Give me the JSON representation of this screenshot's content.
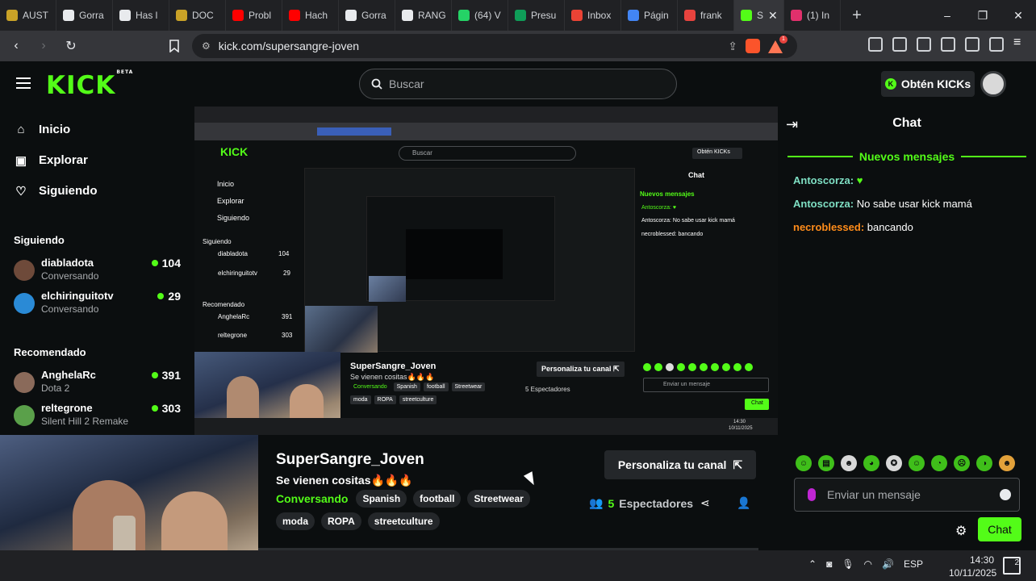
{
  "browser": {
    "tabs": [
      {
        "label": "AUST",
        "color": "#c9a227"
      },
      {
        "label": "Gorra",
        "color": "#e8eaed"
      },
      {
        "label": "Has l",
        "color": "#e8eaed"
      },
      {
        "label": "DOC",
        "color": "#c9a227"
      },
      {
        "label": "Probl",
        "color": "#ff0000"
      },
      {
        "label": "Hach",
        "color": "#ff0000"
      },
      {
        "label": "Gorra",
        "color": "#e8eaed"
      },
      {
        "label": "RANG",
        "color": "#e8eaed"
      },
      {
        "label": "(64) V",
        "color": "#25d366"
      },
      {
        "label": "Presu",
        "color": "#0f9d58"
      },
      {
        "label": "Inbox",
        "color": "#ea4335"
      },
      {
        "label": "Págin",
        "color": "#4285f4"
      },
      {
        "label": "frank",
        "color": "#e8433e"
      },
      {
        "label": "S",
        "color": "#53fc18",
        "active": true
      },
      {
        "label": "(1) In",
        "color": "#e1306c"
      }
    ],
    "new_tab": "+",
    "url": "kick.com/supersangre-joven",
    "window_controls": {
      "minimize": "–",
      "maximize": "❐",
      "close": "✕"
    }
  },
  "kick": {
    "logo": "KICK",
    "logo_badge": "BETA",
    "search_placeholder": "Buscar",
    "get_kicks": "Obtén KICKs"
  },
  "sidebar": {
    "nav": [
      {
        "label": "Inicio",
        "icon": "home-icon"
      },
      {
        "label": "Explorar",
        "icon": "explore-icon"
      },
      {
        "label": "Siguiendo",
        "icon": "heart-icon"
      }
    ],
    "following_header": "Siguiendo",
    "following": [
      {
        "name": "diabladota",
        "status": "Conversando",
        "viewers": "104",
        "color": "#6e4a3a"
      },
      {
        "name": "elchiringuitotv",
        "status": "Conversando",
        "viewers": "29",
        "color": "#2a8ad6"
      }
    ],
    "recommended_header": "Recomendado",
    "recommended": [
      {
        "name": "AnghelaRc",
        "status": "Dota 2",
        "viewers": "391",
        "color": "#8a6a5a"
      },
      {
        "name": "reltegrone",
        "status": "Silent Hill 2 Remake",
        "viewers": "303",
        "color": "#5aa04a"
      }
    ]
  },
  "mini": {
    "logo": "KICK",
    "search": "Buscar",
    "get_kicks": "Obtén KICKs",
    "nav": [
      "Inicio",
      "Explorar",
      "Siguiendo"
    ],
    "following_header": "Siguiendo",
    "chan1": "diabladota",
    "chan1_count": "104",
    "chan2": "elchiringuitotv",
    "chan2_count": "29",
    "recommended_header": "Recomendado",
    "chan3": "AnghelaRc",
    "chan3_count": "391",
    "chan4": "reltegrone",
    "chan4_count": "303",
    "streamer": "SuperSangre_Joven",
    "title": "Se vienen cositas🔥🔥🔥",
    "category": "Conversando",
    "tags": [
      "Spanish",
      "football",
      "Streetwear"
    ],
    "tags2": [
      "moda",
      "ROPA",
      "streetculture"
    ],
    "personaliza": "Personaliza tu canal ⇱",
    "viewers": "5 Espectadores",
    "chat_title": "Chat",
    "new_messages": "Nuevos mensajes",
    "msg1": "Antoscorza: ♥",
    "msg2": "Antoscorza: No sabe usar kick mamá",
    "msg3": "necroblessed: bancando",
    "input": "Enviar un mensaje",
    "chat_button": "Chat",
    "clock_time": "14:30",
    "clock_date": "10/11/2025"
  },
  "chat": {
    "title": "Chat",
    "new_messages": "Nuevos mensajes",
    "messages": [
      {
        "user": "Antoscorza",
        "text": " ♥",
        "color": "#7fe0c4"
      },
      {
        "user": "Antoscorza",
        "text": " No sabe usar kick mamá",
        "color": "#7fe0c4"
      },
      {
        "user": "necroblessed",
        "text": " bancando",
        "color": "#ff8c1a"
      }
    ],
    "input_placeholder": "Enviar un mensaje",
    "send_label": "Chat"
  },
  "stream": {
    "streamer": "SuperSangre_Joven",
    "title": "Se vienen cositas🔥🔥🔥",
    "category": "Conversando",
    "tags": [
      "Spanish",
      "football",
      "Streetwear"
    ],
    "tags2": [
      "moda",
      "ROPA",
      "streetculture"
    ],
    "customize": "Personaliza tu canal",
    "viewers_count": "5",
    "viewers_label": "Espectadores"
  },
  "taskbar": {
    "language": "ESP",
    "time": "14:30",
    "date": "10/11/2025",
    "notifications": "2"
  }
}
